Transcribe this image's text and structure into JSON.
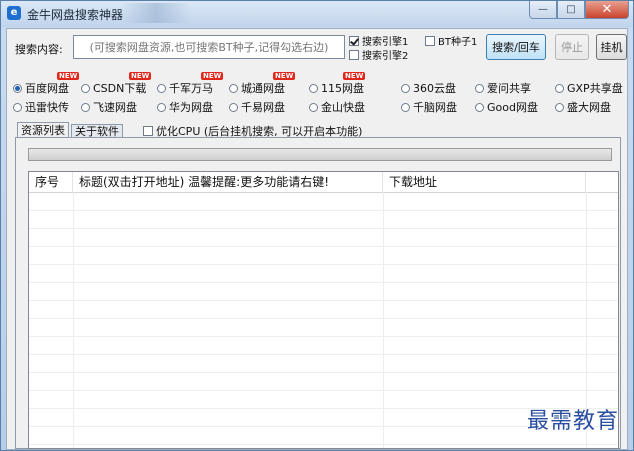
{
  "window": {
    "title": "金牛网盘搜索神器",
    "app_icon_glyph": "e",
    "buttons": {
      "minimize_glyph": "—",
      "maximize_glyph": "□",
      "close_glyph": "✕"
    }
  },
  "search": {
    "label": "搜索内容:",
    "placeholder": "(可搜索网盘资源,也可搜索BT种子,记得勾选右边)"
  },
  "engines": {
    "engine1": {
      "label": "搜索引擎1",
      "checked": true
    },
    "engine2": {
      "label": "搜索引擎2",
      "checked": false
    },
    "bt": {
      "label": "BT种子1",
      "checked": false
    }
  },
  "buttons": {
    "search": "搜索/回车",
    "stop": "停止",
    "hang": "挂机"
  },
  "sources": [
    {
      "label": "百度网盘",
      "checked": true,
      "badge": "NEW"
    },
    {
      "label": "CSDN下载",
      "checked": false,
      "badge": "NEW"
    },
    {
      "label": "千军万马",
      "checked": false,
      "badge": "NEW"
    },
    {
      "label": "城通网盘",
      "checked": false,
      "badge": "NEW"
    },
    {
      "label": "115网盘",
      "checked": false,
      "badge": "NEW"
    },
    {
      "label": "360云盘",
      "checked": false,
      "badge": ""
    },
    {
      "label": "爱问共享",
      "checked": false,
      "badge": ""
    },
    {
      "label": "GXP共享盘",
      "checked": false,
      "badge": ""
    },
    {
      "label": "迅雷快传",
      "checked": false,
      "badge": ""
    },
    {
      "label": "飞速网盘",
      "checked": false,
      "badge": ""
    },
    {
      "label": "华为网盘",
      "checked": false,
      "badge": ""
    },
    {
      "label": "千易网盘",
      "checked": false,
      "badge": ""
    },
    {
      "label": "金山快盘",
      "checked": false,
      "badge": ""
    },
    {
      "label": "千脑网盘",
      "checked": false,
      "badge": ""
    },
    {
      "label": "Good网盘",
      "checked": false,
      "badge": ""
    },
    {
      "label": "盛大网盘",
      "checked": false,
      "badge": ""
    }
  ],
  "tabs": [
    {
      "label": "资源列表",
      "active": true
    },
    {
      "label": "关于软件",
      "active": false
    }
  ],
  "cpu_option": {
    "label": "优化CPU (后台挂机搜索, 可以开启本功能)",
    "checked": false
  },
  "progress": {
    "fraction": 0
  },
  "table": {
    "columns": [
      "序号",
      "标题(双击打开地址) 温馨提醒:更多功能请右键!",
      "下载地址"
    ],
    "rows": []
  },
  "watermark": "最需教育",
  "colors": {
    "accent": "#3c7fb1",
    "badge": "#e0261b",
    "close": "#c9432d",
    "watermark": "#2b4fa0"
  }
}
